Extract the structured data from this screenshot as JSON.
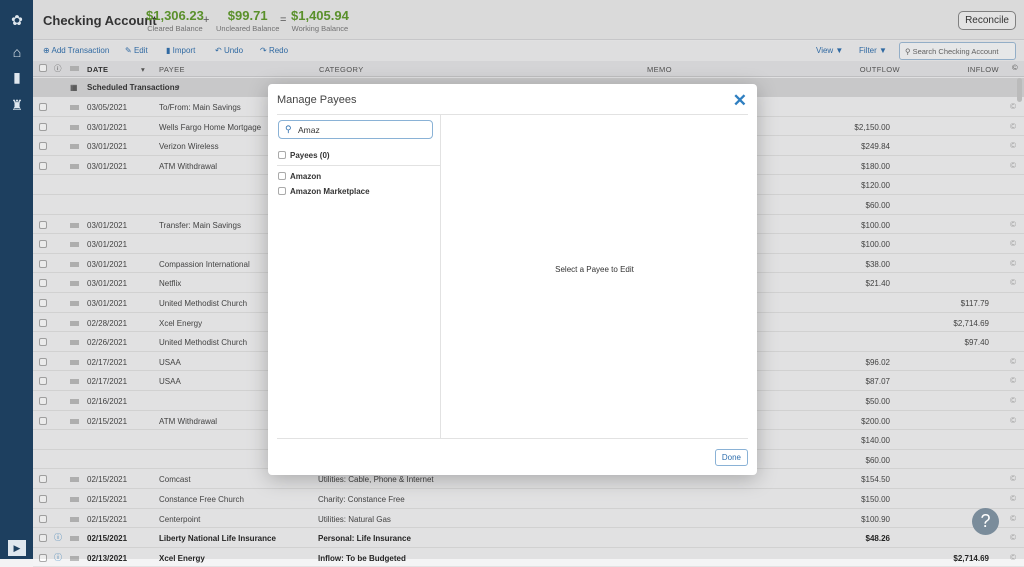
{
  "sidebar": {
    "icons": [
      "tree-logo-icon",
      "bank-icon",
      "reports-icon",
      "institution-icon",
      "collapse-icon"
    ]
  },
  "header": {
    "title": "Checking Account",
    "cleared": {
      "value": "$1,306.23",
      "label": "Cleared Balance"
    },
    "uncleared": {
      "value": "$99.71",
      "label": "Uncleared Balance"
    },
    "working": {
      "value": "$1,405.94",
      "label": "Working Balance"
    },
    "plus": "+",
    "equals": "=",
    "reconcile": "Reconcile"
  },
  "toolbar": {
    "add": "Add Transaction",
    "edit": "Edit",
    "import": "Import",
    "undo": "Undo",
    "redo": "Redo",
    "view": "View ▼",
    "filter": "Filter ▼",
    "search_placeholder": "Search Checking Account"
  },
  "columns": {
    "date": "DATE",
    "payee": "PAYEE",
    "category": "CATEGORY",
    "memo": "MEMO",
    "outflow": "OUTFLOW",
    "inflow": "INFLOW"
  },
  "scheduled": "Scheduled Transactions",
  "rows": [
    {
      "date": "03/05/2021",
      "payee": "To/From: Main Savings",
      "category": "",
      "outflow": "",
      "inflow": "",
      "cleared": true
    },
    {
      "date": "03/01/2021",
      "payee": "Wells Fargo Home Mortgage",
      "category": "",
      "outflow": "$2,150.00",
      "inflow": "",
      "cleared": true
    },
    {
      "date": "03/01/2021",
      "payee": "Verizon Wireless",
      "category": "",
      "outflow": "$249.84",
      "inflow": "",
      "cleared": true
    },
    {
      "date": "03/01/2021",
      "payee": "ATM Withdrawal",
      "category": "",
      "outflow": "$180.00",
      "inflow": "",
      "cleared": true
    },
    {
      "split": true,
      "outflow": "$120.00"
    },
    {
      "split": true,
      "outflow": "$60.00"
    },
    {
      "date": "03/01/2021",
      "payee": "Transfer: Main Savings",
      "category": "",
      "outflow": "$100.00",
      "inflow": "",
      "cleared": true
    },
    {
      "date": "03/01/2021",
      "payee": "",
      "category": "",
      "outflow": "$100.00",
      "inflow": "",
      "cleared": true
    },
    {
      "date": "03/01/2021",
      "payee": "Compassion International",
      "category": "",
      "outflow": "$38.00",
      "inflow": "",
      "cleared": true
    },
    {
      "date": "03/01/2021",
      "payee": "Netflix",
      "category": "",
      "outflow": "$21.40",
      "inflow": "",
      "cleared": true
    },
    {
      "date": "03/01/2021",
      "payee": "United Methodist Church",
      "category": "",
      "outflow": "",
      "inflow": "$117.79",
      "cleared": false
    },
    {
      "date": "02/28/2021",
      "payee": "Xcel Energy",
      "category": "",
      "outflow": "",
      "inflow": "$2,714.69",
      "cleared": false
    },
    {
      "date": "02/26/2021",
      "payee": "United Methodist Church",
      "category": "",
      "outflow": "",
      "inflow": "$97.40",
      "cleared": false
    },
    {
      "date": "02/17/2021",
      "payee": "USAA",
      "category": "",
      "outflow": "$96.02",
      "inflow": "",
      "cleared": true
    },
    {
      "date": "02/17/2021",
      "payee": "USAA",
      "category": "",
      "outflow": "$87.07",
      "inflow": "",
      "cleared": true
    },
    {
      "date": "02/16/2021",
      "payee": "",
      "category": "",
      "outflow": "$50.00",
      "inflow": "",
      "cleared": true
    },
    {
      "date": "02/15/2021",
      "payee": "ATM Withdrawal",
      "category": "",
      "outflow": "$200.00",
      "inflow": "",
      "cleared": true
    },
    {
      "split": true,
      "outflow": "$140.00"
    },
    {
      "split": true,
      "outflow": "$60.00"
    },
    {
      "date": "02/15/2021",
      "payee": "Comcast",
      "category": "Utilities: Cable, Phone & Internet",
      "outflow": "$154.50",
      "inflow": "",
      "cleared": true
    },
    {
      "date": "02/15/2021",
      "payee": "Constance Free Church",
      "category": "Charity: Constance Free",
      "outflow": "$150.00",
      "inflow": "",
      "cleared": true
    },
    {
      "date": "02/15/2021",
      "payee": "Centerpoint",
      "category": "Utilities: Natural Gas",
      "outflow": "$100.90",
      "inflow": "",
      "cleared": true
    },
    {
      "date": "02/15/2021",
      "payee": "Liberty National Life Insurance",
      "category": "Personal: Life Insurance",
      "outflow": "$48.26",
      "inflow": "",
      "cleared": true,
      "bold": true,
      "info": true
    },
    {
      "date": "02/13/2021",
      "payee": "Xcel Energy",
      "category": "Inflow: To be Budgeted",
      "outflow": "",
      "inflow": "$2,714.69",
      "cleared": true,
      "bold": true,
      "info": true
    }
  ],
  "modal": {
    "title": "Manage Payees",
    "search_value": "Amaz",
    "all_label": "Payees (0)",
    "payees": [
      "Amazon",
      "Amazon Marketplace"
    ],
    "empty": "Select a Payee to Edit",
    "done": "Done"
  },
  "help": "?",
  "colors": {
    "sidebar": "#1d3f5f",
    "balance": "#5e9a2a",
    "accent": "#2f7fc1"
  }
}
